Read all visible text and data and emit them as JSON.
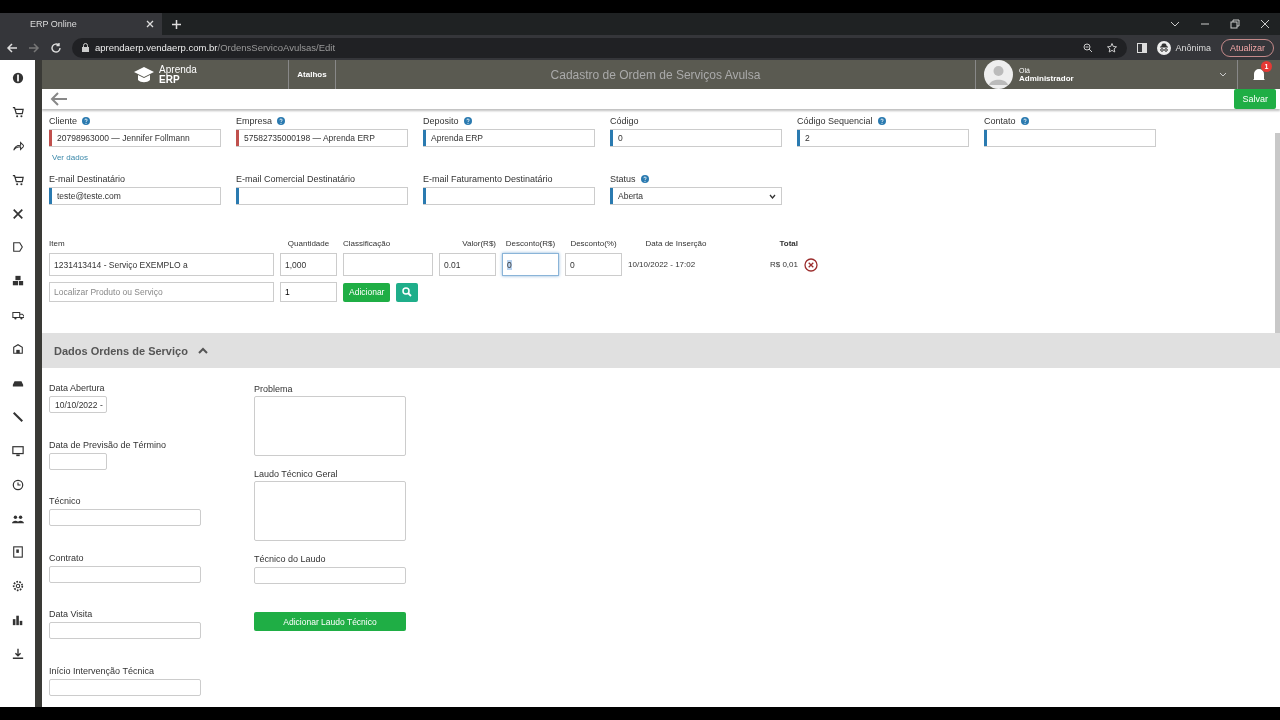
{
  "browser": {
    "tab_title": "ERP Online",
    "url_host": "aprendaerp.vendaerp.com.br",
    "url_path": "/OrdensServicoAvulsas/Edit",
    "profile": "Anônima",
    "update_button": "Atualizar"
  },
  "header": {
    "logo_line1": "Aprenda",
    "logo_line2": "ERP",
    "shortcuts": "Atalhos",
    "title": "Cadastro de Ordem de Serviços Avulsa",
    "greeting": "Olá",
    "user": "Administrador",
    "notification_count": "1"
  },
  "toolbar": {
    "save_button": "Salvar"
  },
  "fields": [
    {
      "label": "Cliente",
      "help": true,
      "value": "20798963000 — Jennifer Follmann",
      "color": "#c0504d",
      "link": "Ver dados"
    },
    {
      "label": "Empresa",
      "help": true,
      "value": "57582735000198 — Aprenda ERP",
      "color": "#c0504d"
    },
    {
      "label": "Deposito",
      "help": true,
      "value": "Aprenda ERP",
      "color": "#2a7ab0"
    },
    {
      "label": "Código",
      "help": false,
      "value": "0",
      "color": "#2a7ab0"
    },
    {
      "label": "Código Sequencial",
      "help": true,
      "value": "2",
      "color": "#2a7ab0"
    },
    {
      "label": "Contato",
      "help": true,
      "color": "#2a7ab0"
    }
  ],
  "fields_2": [
    {
      "label": "E-mail Destinatário",
      "help": false,
      "value": "teste@teste.com",
      "color": "#2a7ab0",
      "kind": "input"
    },
    {
      "label": "E-mail Comercial Destinatário",
      "help": false,
      "color": "#2a7ab0",
      "kind": "input"
    },
    {
      "label": "E-mail Faturamento Destinatário",
      "help": false,
      "color": "#2a7ab0",
      "kind": "input"
    },
    {
      "label": "Status",
      "help": true,
      "value": "Aberta",
      "color": "#2a7ab0",
      "kind": "select"
    }
  ],
  "items": {
    "columns": [
      "Item",
      "Quantidade",
      "Classificação",
      "Valor(R$)",
      "Desconto(R$)",
      "Desconto(%)",
      "Data de Inserção",
      "Total"
    ],
    "row": [
      {
        "kind": "input",
        "value": "1231413414 - Serviço EXEMPLO a",
        "focused": false
      },
      {
        "kind": "input",
        "value": "1,000",
        "focused": false
      },
      {
        "kind": "input",
        "focused": false
      },
      {
        "kind": "input",
        "value": "0.01",
        "focused": false
      },
      {
        "kind": "input",
        "value": "0",
        "focused": true
      },
      {
        "kind": "input",
        "value": "0",
        "focused": false
      },
      {
        "kind": "text",
        "value": "10/10/2022 - 17:02"
      },
      {
        "kind": "text",
        "value": "R$ 0,01"
      }
    ],
    "search": {
      "placeholder": "Localizar Produto ou Serviço",
      "quantity": "1",
      "add_button": "Adicionar"
    }
  },
  "section": {
    "title": "Dados Ordens de Serviço",
    "expanded": true,
    "left": [
      {
        "label": "Data Abertura",
        "kind": "date",
        "value": "10/10/2022 -"
      },
      {
        "label": "Data de Previsão de Término",
        "kind": "date"
      },
      {
        "label": "Técnico",
        "kind": "text"
      },
      {
        "label": "Contrato",
        "kind": "text"
      },
      {
        "label": "Data Visita",
        "kind": "text"
      },
      {
        "label": "Início Intervenção Técnica",
        "kind": "text"
      }
    ],
    "right": [
      {
        "label": "Problema",
        "kind": "textarea"
      },
      {
        "label": "Laudo Técnico Geral",
        "kind": "textarea"
      },
      {
        "label": "Técnico do Laudo",
        "kind": "text"
      }
    ],
    "button": "Adicionar Laudo Técnico"
  }
}
